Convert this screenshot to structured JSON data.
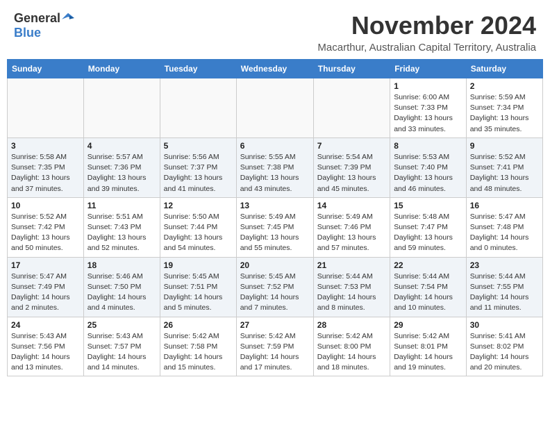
{
  "header": {
    "logo_general": "General",
    "logo_blue": "Blue",
    "month_title": "November 2024",
    "subtitle": "Macarthur, Australian Capital Territory, Australia"
  },
  "weekdays": [
    "Sunday",
    "Monday",
    "Tuesday",
    "Wednesday",
    "Thursday",
    "Friday",
    "Saturday"
  ],
  "weeks": [
    [
      {
        "day": "",
        "info": ""
      },
      {
        "day": "",
        "info": ""
      },
      {
        "day": "",
        "info": ""
      },
      {
        "day": "",
        "info": ""
      },
      {
        "day": "",
        "info": ""
      },
      {
        "day": "1",
        "info": "Sunrise: 6:00 AM\nSunset: 7:33 PM\nDaylight: 13 hours\nand 33 minutes."
      },
      {
        "day": "2",
        "info": "Sunrise: 5:59 AM\nSunset: 7:34 PM\nDaylight: 13 hours\nand 35 minutes."
      }
    ],
    [
      {
        "day": "3",
        "info": "Sunrise: 5:58 AM\nSunset: 7:35 PM\nDaylight: 13 hours\nand 37 minutes."
      },
      {
        "day": "4",
        "info": "Sunrise: 5:57 AM\nSunset: 7:36 PM\nDaylight: 13 hours\nand 39 minutes."
      },
      {
        "day": "5",
        "info": "Sunrise: 5:56 AM\nSunset: 7:37 PM\nDaylight: 13 hours\nand 41 minutes."
      },
      {
        "day": "6",
        "info": "Sunrise: 5:55 AM\nSunset: 7:38 PM\nDaylight: 13 hours\nand 43 minutes."
      },
      {
        "day": "7",
        "info": "Sunrise: 5:54 AM\nSunset: 7:39 PM\nDaylight: 13 hours\nand 45 minutes."
      },
      {
        "day": "8",
        "info": "Sunrise: 5:53 AM\nSunset: 7:40 PM\nDaylight: 13 hours\nand 46 minutes."
      },
      {
        "day": "9",
        "info": "Sunrise: 5:52 AM\nSunset: 7:41 PM\nDaylight: 13 hours\nand 48 minutes."
      }
    ],
    [
      {
        "day": "10",
        "info": "Sunrise: 5:52 AM\nSunset: 7:42 PM\nDaylight: 13 hours\nand 50 minutes."
      },
      {
        "day": "11",
        "info": "Sunrise: 5:51 AM\nSunset: 7:43 PM\nDaylight: 13 hours\nand 52 minutes."
      },
      {
        "day": "12",
        "info": "Sunrise: 5:50 AM\nSunset: 7:44 PM\nDaylight: 13 hours\nand 54 minutes."
      },
      {
        "day": "13",
        "info": "Sunrise: 5:49 AM\nSunset: 7:45 PM\nDaylight: 13 hours\nand 55 minutes."
      },
      {
        "day": "14",
        "info": "Sunrise: 5:49 AM\nSunset: 7:46 PM\nDaylight: 13 hours\nand 57 minutes."
      },
      {
        "day": "15",
        "info": "Sunrise: 5:48 AM\nSunset: 7:47 PM\nDaylight: 13 hours\nand 59 minutes."
      },
      {
        "day": "16",
        "info": "Sunrise: 5:47 AM\nSunset: 7:48 PM\nDaylight: 14 hours\nand 0 minutes."
      }
    ],
    [
      {
        "day": "17",
        "info": "Sunrise: 5:47 AM\nSunset: 7:49 PM\nDaylight: 14 hours\nand 2 minutes."
      },
      {
        "day": "18",
        "info": "Sunrise: 5:46 AM\nSunset: 7:50 PM\nDaylight: 14 hours\nand 4 minutes."
      },
      {
        "day": "19",
        "info": "Sunrise: 5:45 AM\nSunset: 7:51 PM\nDaylight: 14 hours\nand 5 minutes."
      },
      {
        "day": "20",
        "info": "Sunrise: 5:45 AM\nSunset: 7:52 PM\nDaylight: 14 hours\nand 7 minutes."
      },
      {
        "day": "21",
        "info": "Sunrise: 5:44 AM\nSunset: 7:53 PM\nDaylight: 14 hours\nand 8 minutes."
      },
      {
        "day": "22",
        "info": "Sunrise: 5:44 AM\nSunset: 7:54 PM\nDaylight: 14 hours\nand 10 minutes."
      },
      {
        "day": "23",
        "info": "Sunrise: 5:44 AM\nSunset: 7:55 PM\nDaylight: 14 hours\nand 11 minutes."
      }
    ],
    [
      {
        "day": "24",
        "info": "Sunrise: 5:43 AM\nSunset: 7:56 PM\nDaylight: 14 hours\nand 13 minutes."
      },
      {
        "day": "25",
        "info": "Sunrise: 5:43 AM\nSunset: 7:57 PM\nDaylight: 14 hours\nand 14 minutes."
      },
      {
        "day": "26",
        "info": "Sunrise: 5:42 AM\nSunset: 7:58 PM\nDaylight: 14 hours\nand 15 minutes."
      },
      {
        "day": "27",
        "info": "Sunrise: 5:42 AM\nSunset: 7:59 PM\nDaylight: 14 hours\nand 17 minutes."
      },
      {
        "day": "28",
        "info": "Sunrise: 5:42 AM\nSunset: 8:00 PM\nDaylight: 14 hours\nand 18 minutes."
      },
      {
        "day": "29",
        "info": "Sunrise: 5:42 AM\nSunset: 8:01 PM\nDaylight: 14 hours\nand 19 minutes."
      },
      {
        "day": "30",
        "info": "Sunrise: 5:41 AM\nSunset: 8:02 PM\nDaylight: 14 hours\nand 20 minutes."
      }
    ]
  ]
}
